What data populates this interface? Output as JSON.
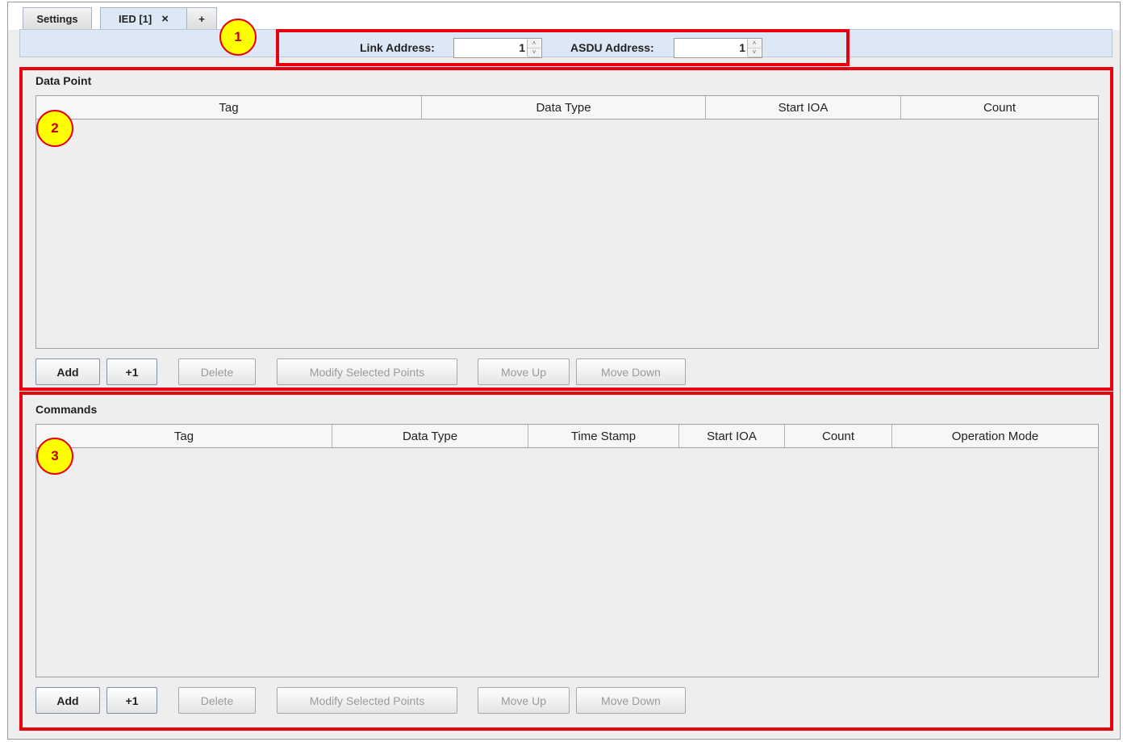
{
  "tabs": [
    {
      "label": "Settings"
    },
    {
      "label": "IED [1]",
      "close": "×"
    },
    {
      "label": "+"
    }
  ],
  "address": {
    "link_label": "Link Address:",
    "link_value": "1",
    "asdu_label": "ASDU Address:",
    "asdu_value": "1",
    "spin_up": "˄",
    "spin_down": "˅"
  },
  "markers": [
    "1",
    "2",
    "3"
  ],
  "data_point": {
    "title": "Data Point",
    "columns": [
      "Tag",
      "Data Type",
      "Start IOA",
      "Count"
    ],
    "rows": [],
    "buttons": {
      "add": "Add",
      "plus_one": "+1",
      "delete": "Delete",
      "modify": "Modify Selected Points",
      "move_up": "Move Up",
      "move_down": "Move Down"
    }
  },
  "commands": {
    "title": "Commands",
    "columns": [
      "Tag",
      "Data Type",
      "Time Stamp",
      "Start IOA",
      "Count",
      "Operation Mode"
    ],
    "rows": [],
    "buttons": {
      "add": "Add",
      "plus_one": "+1",
      "delete": "Delete",
      "modify": "Modify Selected Points",
      "move_up": "Move Up",
      "move_down": "Move Down"
    }
  },
  "colors": {
    "highlight": "#e8000e",
    "marker_fill": "#ffff00",
    "tab_active": "#dde8f6"
  }
}
